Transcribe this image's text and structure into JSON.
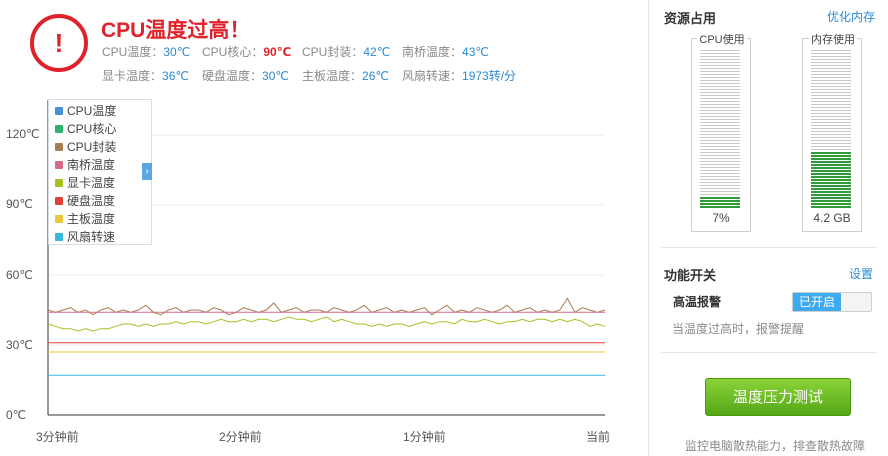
{
  "header": {
    "alert_glyph": "!",
    "title": "CPU温度过高！",
    "stats": [
      {
        "label": "CPU温度：",
        "value": "30℃",
        "hot": false
      },
      {
        "label": "CPU核心：",
        "value": "90℃",
        "hot": true
      },
      {
        "label": "CPU封装：",
        "value": "42℃",
        "hot": false
      },
      {
        "label": "南桥温度：",
        "value": "43℃",
        "hot": false
      },
      {
        "label": "显卡温度：",
        "value": "36℃",
        "hot": false
      },
      {
        "label": "硬盘温度：",
        "value": "30℃",
        "hot": false
      },
      {
        "label": "主板温度：",
        "value": "26℃",
        "hot": false
      },
      {
        "label": "风扇转速：",
        "value": "1973转/分",
        "hot": false
      }
    ]
  },
  "chart_data": {
    "type": "line",
    "y_ticks": [
      "120℃",
      "90℃",
      "60℃",
      "30℃",
      "0℃"
    ],
    "y_tick_values": [
      120,
      90,
      60,
      30,
      0
    ],
    "ylim": [
      0,
      120
    ],
    "x_ticks": [
      "3分钟前",
      "2分钟前",
      "1分钟前",
      "当前"
    ],
    "x_tick_positions": [
      0,
      1,
      2,
      3
    ],
    "xlim": [
      0,
      3
    ],
    "grid": true,
    "legend_placement": "top-left",
    "legend_toggle_glyph": "›",
    "series": [
      {
        "name": "CPU温度",
        "color": "#4a90d9",
        "values": []
      },
      {
        "name": "CPU核心",
        "color": "#2fb36f",
        "values": []
      },
      {
        "name": "CPU封装",
        "color": "#a67c52",
        "values": [
          45,
          44,
          45,
          46,
          44,
          45,
          43,
          45,
          46,
          44,
          45,
          44,
          45,
          47,
          44,
          43,
          45,
          46,
          44,
          45,
          45,
          44,
          46,
          45,
          43,
          44,
          46,
          45,
          44,
          45,
          48,
          44,
          45,
          46,
          44,
          45,
          45,
          44,
          46,
          45,
          44,
          45,
          47,
          44,
          45,
          46,
          44,
          45,
          44,
          45,
          46,
          43,
          45,
          47,
          44,
          45,
          44,
          46,
          45,
          44,
          45,
          47,
          44,
          45,
          46,
          44,
          45,
          44,
          45,
          50,
          44,
          46,
          45,
          44,
          45
        ]
      },
      {
        "name": "南桥温度",
        "color": "#d66a8a",
        "values": [
          44,
          44,
          44,
          44,
          44,
          44,
          44,
          44,
          44,
          44,
          44,
          44,
          44,
          44,
          44,
          44,
          44,
          44,
          44,
          44,
          44,
          44,
          44,
          44,
          44,
          44,
          44,
          44,
          44,
          44,
          44,
          44,
          44,
          44,
          44,
          44,
          44,
          44,
          44,
          44,
          44,
          44,
          44,
          44,
          44,
          44,
          44,
          44,
          44,
          44,
          44,
          44,
          44,
          44,
          44,
          44,
          44,
          44,
          44,
          44,
          44,
          44,
          44,
          44,
          44,
          44,
          44,
          44,
          44,
          44,
          44,
          44,
          44,
          44,
          44
        ]
      },
      {
        "name": "显卡温度",
        "color": "#a8c020",
        "values": [
          39,
          38,
          37,
          37,
          36,
          37,
          36,
          37,
          37,
          38,
          39,
          39,
          38,
          39,
          38,
          39,
          39,
          40,
          39,
          40,
          40,
          39,
          40,
          41,
          40,
          40,
          41,
          40,
          41,
          41,
          40,
          41,
          42,
          41,
          41,
          40,
          41,
          42,
          40,
          41,
          40,
          39,
          39,
          38,
          39,
          38,
          39,
          39,
          38,
          39,
          40,
          39,
          40,
          40,
          39,
          41,
          40,
          40,
          41,
          40,
          39,
          40,
          40,
          41,
          40,
          41,
          41,
          40,
          41,
          40,
          41,
          40,
          38,
          39,
          38
        ]
      },
      {
        "name": "硬盘温度",
        "color": "#e0403a",
        "values": [
          31,
          31,
          31,
          31,
          31,
          31,
          31,
          31,
          31,
          31,
          31,
          31,
          31,
          31,
          31,
          31,
          31,
          31,
          31,
          31,
          31,
          31,
          31,
          31,
          31,
          31,
          31,
          31,
          31,
          31,
          31,
          31,
          31,
          31,
          31,
          31,
          31,
          31,
          31,
          31,
          31,
          31,
          31,
          31,
          31,
          31,
          31,
          31,
          31,
          31,
          31,
          31,
          31,
          31,
          31,
          31,
          31,
          31,
          31,
          31,
          31,
          31,
          31,
          31,
          31,
          31,
          31,
          31,
          31,
          31,
          31,
          31,
          31,
          31,
          31
        ]
      },
      {
        "name": "主板温度",
        "color": "#e8c840",
        "values": [
          27,
          27,
          27,
          27,
          27,
          27,
          27,
          27,
          27,
          27,
          27,
          27,
          27,
          27,
          27,
          27,
          27,
          27,
          27,
          27,
          27,
          27,
          27,
          27,
          27,
          27,
          27,
          27,
          27,
          27,
          27,
          27,
          27,
          27,
          27,
          27,
          27,
          27,
          27,
          27,
          27,
          27,
          27,
          27,
          27,
          27,
          27,
          27,
          27,
          27,
          27,
          27,
          27,
          27,
          27,
          27,
          27,
          27,
          27,
          27,
          27,
          27,
          27,
          27,
          27,
          27,
          27,
          27,
          27,
          27,
          27,
          27,
          27,
          27,
          27
        ]
      },
      {
        "name": "风扇转速",
        "color": "#3ab8e0",
        "values": [
          17,
          17,
          17,
          17,
          17,
          17,
          17,
          17,
          17,
          17,
          17,
          17,
          17,
          17,
          17,
          17,
          17,
          17,
          17,
          17,
          17,
          17,
          17,
          17,
          17,
          17,
          17,
          17,
          17,
          17,
          17,
          17,
          17,
          17,
          17,
          17,
          17,
          17,
          17,
          17,
          17,
          17,
          17,
          17,
          17,
          17,
          17,
          17,
          17,
          17,
          17,
          17,
          17,
          17,
          17,
          17,
          17,
          17,
          17,
          17,
          17,
          17,
          17,
          17,
          17,
          17,
          17,
          17,
          17,
          17,
          17,
          17,
          17,
          17,
          17
        ]
      }
    ]
  },
  "resources": {
    "title": "资源占用",
    "optimize_link": "优化内存",
    "cpu": {
      "label": "CPU使用",
      "value_text": "7%",
      "fraction": 0.07
    },
    "memory": {
      "label": "内存使用",
      "value_text": "4.2 GB",
      "fraction": 0.36
    },
    "meter_colors": {
      "filled": "#2e9a3a",
      "empty": "#c8c8c8"
    }
  },
  "functions": {
    "title": "功能开关",
    "settings_link": "设置",
    "alarm_label": "高温报警",
    "alarm_state": "已开启",
    "alarm_desc": "当温度过高时，报警提醒"
  },
  "stress": {
    "button_label": "温度压力测试",
    "desc": "监控电脑散热能力，排查散热故障"
  }
}
